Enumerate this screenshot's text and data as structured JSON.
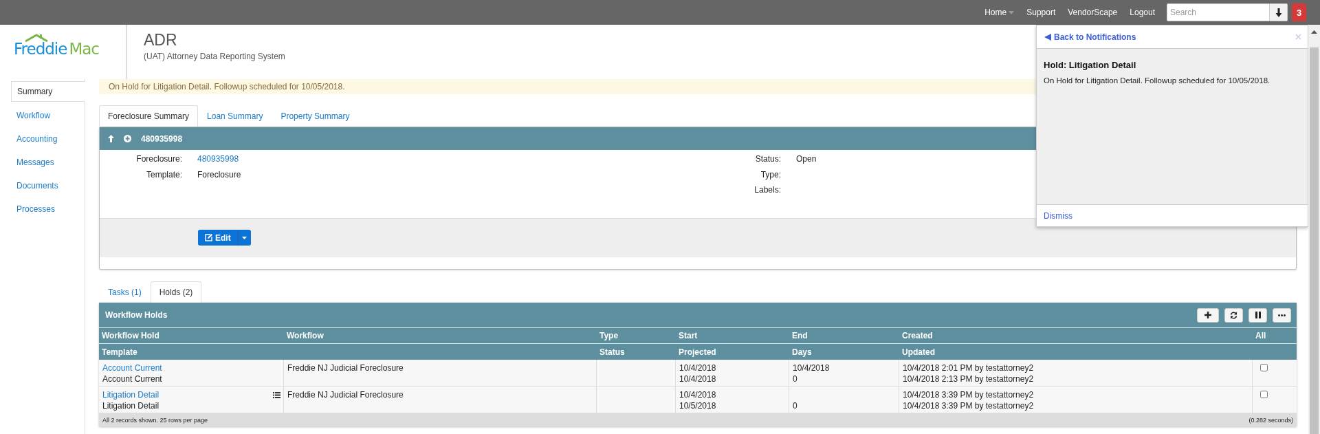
{
  "top_nav": {
    "links": [
      {
        "label": "Home",
        "dropdown": true
      },
      {
        "label": "Support",
        "dropdown": false
      },
      {
        "label": "VendorScape",
        "dropdown": false
      },
      {
        "label": "Logout",
        "dropdown": false
      }
    ],
    "search": {
      "placeholder": "Search"
    },
    "notification_count": "3"
  },
  "logo": {
    "words": [
      "Freddie",
      "Mac"
    ]
  },
  "app": {
    "title": "ADR",
    "subtitle": "(UAT) Attorney Data Reporting System"
  },
  "sidebar": {
    "items": [
      {
        "label": "Summary",
        "selected": true
      },
      {
        "label": "Workflow",
        "selected": false
      },
      {
        "label": "Accounting",
        "selected": false
      },
      {
        "label": "Messages",
        "selected": false
      },
      {
        "label": "Documents",
        "selected": false
      },
      {
        "label": "Processes",
        "selected": false
      }
    ]
  },
  "alert": {
    "message": "On Hold for Litigation Detail. Followup scheduled for 10/05/2018."
  },
  "summary_tabs": [
    {
      "label": "Foreclosure Summary",
      "selected": true
    },
    {
      "label": "Loan Summary",
      "selected": false
    },
    {
      "label": "Property Summary",
      "selected": false
    }
  ],
  "record_panel": {
    "title": "480935998",
    "fields_left": [
      {
        "label": "Foreclosure:",
        "value": "480935998",
        "link": true
      },
      {
        "label": "Template:",
        "value": "Foreclosure",
        "link": false
      }
    ],
    "fields_right": [
      {
        "label": "Status:",
        "value": "Open"
      },
      {
        "label": "Type:"
      },
      {
        "label": "Labels:"
      }
    ],
    "edit_button": "Edit"
  },
  "lower_tabs": [
    {
      "label": "Tasks (1)",
      "selected": false
    },
    {
      "label": "Holds (2)",
      "selected": true
    }
  ],
  "holds_table": {
    "title": "Workflow Holds",
    "columns": [
      {
        "top": "Workflow Hold",
        "bottom": "Template"
      },
      {
        "top": "Workflow"
      },
      {
        "top": "Type",
        "bottom": "Status"
      },
      {
        "top": "Start",
        "bottom": "Projected"
      },
      {
        "top": "End",
        "bottom": "Days"
      },
      {
        "top": "Created",
        "bottom": "Updated"
      },
      {
        "top": "All"
      }
    ],
    "rows": [
      {
        "hold": "Account Current",
        "template": "Account Current",
        "list_icon": false,
        "workflow": "Freddie NJ Judicial Foreclosure",
        "start": "10/4/2018",
        "projected": "10/4/2018",
        "end": "10/4/2018",
        "days": "0",
        "created": "10/4/2018 2:01 PM by testattorney2",
        "updated": "10/4/2018 2:13 PM by testattorney2",
        "checked": false
      },
      {
        "hold": "Litigation Detail",
        "template": "Litigation Detail",
        "list_icon": true,
        "workflow": "Freddie NJ Judicial Foreclosure",
        "start": "10/4/2018",
        "projected": "10/5/2018",
        "days": "0",
        "created": "10/4/2018 3:39 PM by testattorney2",
        "updated": "10/4/2018 3:39 PM by testattorney2",
        "checked": false
      }
    ],
    "footer_summary": "All 2 records shown. 25 rows per page",
    "footer_timing": "(0.282 seconds)"
  },
  "notification": {
    "back_link": "Back to Notifications",
    "title": "Hold: Litigation Detail",
    "message": "On Hold for Litigation Detail. Followup scheduled for 10/05/2018.",
    "dismiss": "Dismiss"
  }
}
